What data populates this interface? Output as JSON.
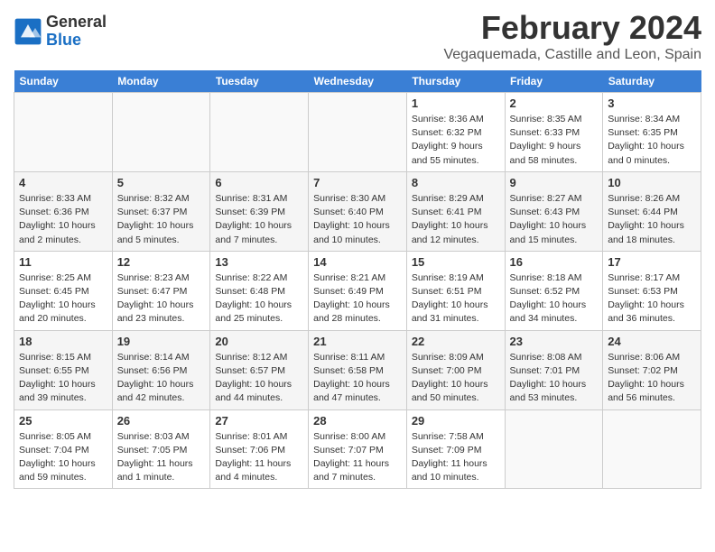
{
  "header": {
    "logo_line1": "General",
    "logo_line2": "Blue",
    "month": "February 2024",
    "location": "Vegaquemada, Castille and Leon, Spain"
  },
  "weekdays": [
    "Sunday",
    "Monday",
    "Tuesday",
    "Wednesday",
    "Thursday",
    "Friday",
    "Saturday"
  ],
  "weeks": [
    [
      {
        "day": "",
        "info": ""
      },
      {
        "day": "",
        "info": ""
      },
      {
        "day": "",
        "info": ""
      },
      {
        "day": "",
        "info": ""
      },
      {
        "day": "1",
        "info": "Sunrise: 8:36 AM\nSunset: 6:32 PM\nDaylight: 9 hours\nand 55 minutes."
      },
      {
        "day": "2",
        "info": "Sunrise: 8:35 AM\nSunset: 6:33 PM\nDaylight: 9 hours\nand 58 minutes."
      },
      {
        "day": "3",
        "info": "Sunrise: 8:34 AM\nSunset: 6:35 PM\nDaylight: 10 hours\nand 0 minutes."
      }
    ],
    [
      {
        "day": "4",
        "info": "Sunrise: 8:33 AM\nSunset: 6:36 PM\nDaylight: 10 hours\nand 2 minutes."
      },
      {
        "day": "5",
        "info": "Sunrise: 8:32 AM\nSunset: 6:37 PM\nDaylight: 10 hours\nand 5 minutes."
      },
      {
        "day": "6",
        "info": "Sunrise: 8:31 AM\nSunset: 6:39 PM\nDaylight: 10 hours\nand 7 minutes."
      },
      {
        "day": "7",
        "info": "Sunrise: 8:30 AM\nSunset: 6:40 PM\nDaylight: 10 hours\nand 10 minutes."
      },
      {
        "day": "8",
        "info": "Sunrise: 8:29 AM\nSunset: 6:41 PM\nDaylight: 10 hours\nand 12 minutes."
      },
      {
        "day": "9",
        "info": "Sunrise: 8:27 AM\nSunset: 6:43 PM\nDaylight: 10 hours\nand 15 minutes."
      },
      {
        "day": "10",
        "info": "Sunrise: 8:26 AM\nSunset: 6:44 PM\nDaylight: 10 hours\nand 18 minutes."
      }
    ],
    [
      {
        "day": "11",
        "info": "Sunrise: 8:25 AM\nSunset: 6:45 PM\nDaylight: 10 hours\nand 20 minutes."
      },
      {
        "day": "12",
        "info": "Sunrise: 8:23 AM\nSunset: 6:47 PM\nDaylight: 10 hours\nand 23 minutes."
      },
      {
        "day": "13",
        "info": "Sunrise: 8:22 AM\nSunset: 6:48 PM\nDaylight: 10 hours\nand 25 minutes."
      },
      {
        "day": "14",
        "info": "Sunrise: 8:21 AM\nSunset: 6:49 PM\nDaylight: 10 hours\nand 28 minutes."
      },
      {
        "day": "15",
        "info": "Sunrise: 8:19 AM\nSunset: 6:51 PM\nDaylight: 10 hours\nand 31 minutes."
      },
      {
        "day": "16",
        "info": "Sunrise: 8:18 AM\nSunset: 6:52 PM\nDaylight: 10 hours\nand 34 minutes."
      },
      {
        "day": "17",
        "info": "Sunrise: 8:17 AM\nSunset: 6:53 PM\nDaylight: 10 hours\nand 36 minutes."
      }
    ],
    [
      {
        "day": "18",
        "info": "Sunrise: 8:15 AM\nSunset: 6:55 PM\nDaylight: 10 hours\nand 39 minutes."
      },
      {
        "day": "19",
        "info": "Sunrise: 8:14 AM\nSunset: 6:56 PM\nDaylight: 10 hours\nand 42 minutes."
      },
      {
        "day": "20",
        "info": "Sunrise: 8:12 AM\nSunset: 6:57 PM\nDaylight: 10 hours\nand 44 minutes."
      },
      {
        "day": "21",
        "info": "Sunrise: 8:11 AM\nSunset: 6:58 PM\nDaylight: 10 hours\nand 47 minutes."
      },
      {
        "day": "22",
        "info": "Sunrise: 8:09 AM\nSunset: 7:00 PM\nDaylight: 10 hours\nand 50 minutes."
      },
      {
        "day": "23",
        "info": "Sunrise: 8:08 AM\nSunset: 7:01 PM\nDaylight: 10 hours\nand 53 minutes."
      },
      {
        "day": "24",
        "info": "Sunrise: 8:06 AM\nSunset: 7:02 PM\nDaylight: 10 hours\nand 56 minutes."
      }
    ],
    [
      {
        "day": "25",
        "info": "Sunrise: 8:05 AM\nSunset: 7:04 PM\nDaylight: 10 hours\nand 59 minutes."
      },
      {
        "day": "26",
        "info": "Sunrise: 8:03 AM\nSunset: 7:05 PM\nDaylight: 11 hours\nand 1 minute."
      },
      {
        "day": "27",
        "info": "Sunrise: 8:01 AM\nSunset: 7:06 PM\nDaylight: 11 hours\nand 4 minutes."
      },
      {
        "day": "28",
        "info": "Sunrise: 8:00 AM\nSunset: 7:07 PM\nDaylight: 11 hours\nand 7 minutes."
      },
      {
        "day": "29",
        "info": "Sunrise: 7:58 AM\nSunset: 7:09 PM\nDaylight: 11 hours\nand 10 minutes."
      },
      {
        "day": "",
        "info": ""
      },
      {
        "day": "",
        "info": ""
      }
    ]
  ]
}
